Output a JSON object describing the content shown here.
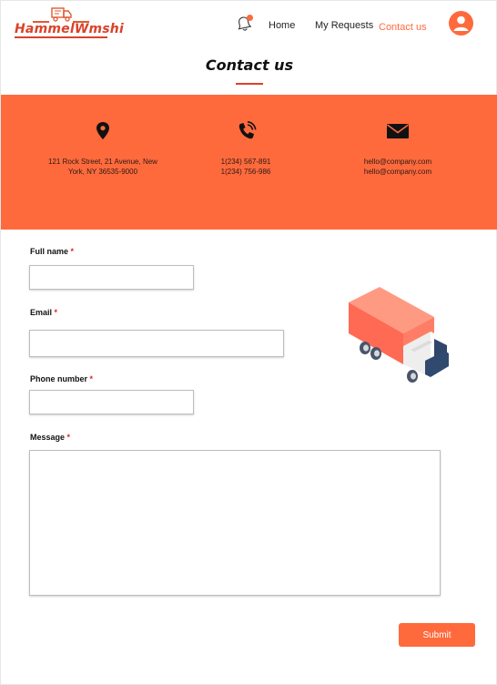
{
  "header": {
    "logo_text": "HammelWmshi",
    "nav": {
      "home": "Home",
      "requests": "My Requests",
      "contact": "Contact us"
    },
    "notification_icon": "bell-icon",
    "avatar_icon": "user-icon"
  },
  "page": {
    "title": "Contact us"
  },
  "contact_info": {
    "address": {
      "icon": "location-pin-icon",
      "line1": "121 Rock Street, 21 Avenue, New",
      "line2": "York, NY 36535-9000"
    },
    "phone": {
      "icon": "phone-icon",
      "line1": "1(234) 567-891",
      "line2": "1(234) 756-986"
    },
    "email": {
      "icon": "envelope-icon",
      "line1": "hello@company.com",
      "line2": "hello@company.com"
    }
  },
  "form": {
    "full_name": {
      "label": "Full name",
      "value": ""
    },
    "email": {
      "label": "Email",
      "value": ""
    },
    "phone": {
      "label": "Phone number",
      "value": ""
    },
    "message": {
      "label": "Message",
      "value": ""
    },
    "required_mark": "*",
    "submit_label": "Submit"
  },
  "illustration": "delivery-truck-illustration",
  "colors": {
    "accent": "#ff6a3d",
    "brand": "#d8432a",
    "required": "#e0262b"
  }
}
